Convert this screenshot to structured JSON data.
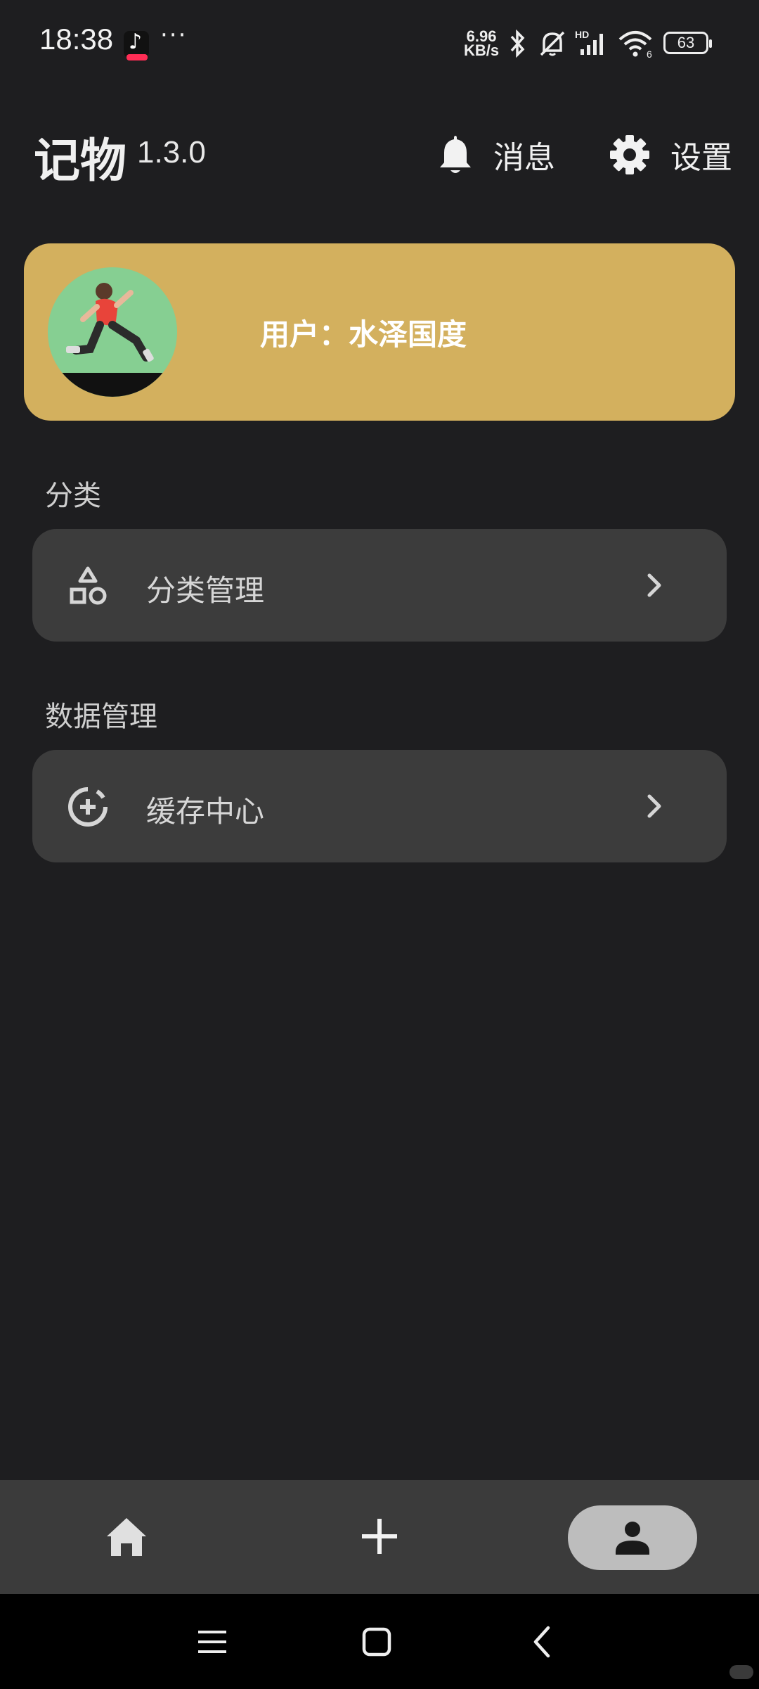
{
  "status_bar": {
    "time": "18:38",
    "more": "···",
    "net_speed_value": "6.96",
    "net_speed_unit": "KB/s",
    "signal_label": "HD",
    "wifi_label": "6",
    "battery": "63"
  },
  "header": {
    "title": "记物",
    "version": "1.3.0",
    "messages_label": "消息",
    "settings_label": "设置"
  },
  "profile": {
    "user_label": "用户：水泽国度",
    "accent_color": "#d3b05e"
  },
  "sections": {
    "category": {
      "title": "分类",
      "item_label": "分类管理"
    },
    "data": {
      "title": "数据管理",
      "item_label": "缓存中心"
    }
  },
  "bottom_nav": {
    "items": [
      "home-icon",
      "add-icon",
      "person-icon"
    ],
    "active": "person-icon"
  }
}
